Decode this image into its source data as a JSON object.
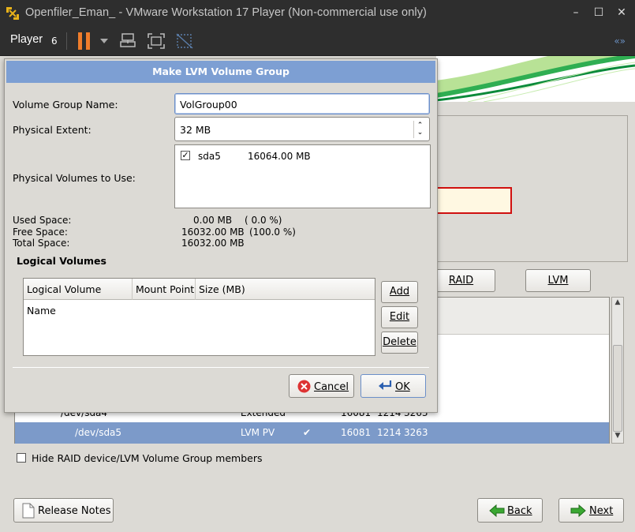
{
  "window": {
    "title": "Openfiler_Eman_ - VMware Workstation 17 Player (Non-commercial use only)",
    "controls": {
      "minimize": "–",
      "maximize": "☐",
      "close": "✕"
    }
  },
  "toolbar": {
    "player_label": "Player",
    "player_number": "6",
    "right_glyph": "«»",
    "icons": [
      "pause-icon",
      "send-keys-icon",
      "fullscreen-icon",
      "unity-icon"
    ]
  },
  "dialog": {
    "title": "Make LVM Volume Group",
    "vg_name_label": "Volume Group Name:",
    "vg_name_value": "VolGroup00",
    "pe_label": "Physical Extent:",
    "pe_value": "32 MB",
    "pv_label": "Physical Volumes to Use:",
    "pv_items": [
      {
        "checked": true,
        "name": "sda5",
        "size": "16064.00 MB"
      }
    ],
    "space": {
      "used_label": "Used Space:",
      "used_value": "0.00 MB",
      "used_pct": "( 0.0 %)",
      "free_label": "Free Space:",
      "free_value": "16032.00 MB",
      "free_pct": "(100.0 %)",
      "total_label": "Total Space:",
      "total_value": "16032.00 MB"
    },
    "lv_section_label": "Logical Volumes",
    "lv_columns": [
      "Logical Volume Name",
      "Mount Point",
      "Size (MB)"
    ],
    "buttons": {
      "add": "Add",
      "edit": "Edit",
      "delete": "Delete",
      "cancel": "Cancel",
      "ok": "OK"
    }
  },
  "installer": {
    "buttons": {
      "raid": "RAID",
      "lvm": "LVM"
    },
    "devices": [
      {
        "device": "/dev/sda4",
        "type": "Extended",
        "format": "",
        "size": "16081",
        "start": "1214",
        "end": "3263"
      },
      {
        "device": "/dev/sda5",
        "type": "LVM PV",
        "format": "✔",
        "size": "16081",
        "start": "1214",
        "end": "3263"
      }
    ],
    "hide_members_label": "Hide RAID device/LVM Volume Group members",
    "release_notes": "Release Notes",
    "back": "Back",
    "next": "Next"
  },
  "colors": {
    "accent": "#7d9fd3",
    "selection": "#7c9ac9",
    "pause": "#f07d2b",
    "titlebar": "#2e2e2e"
  }
}
